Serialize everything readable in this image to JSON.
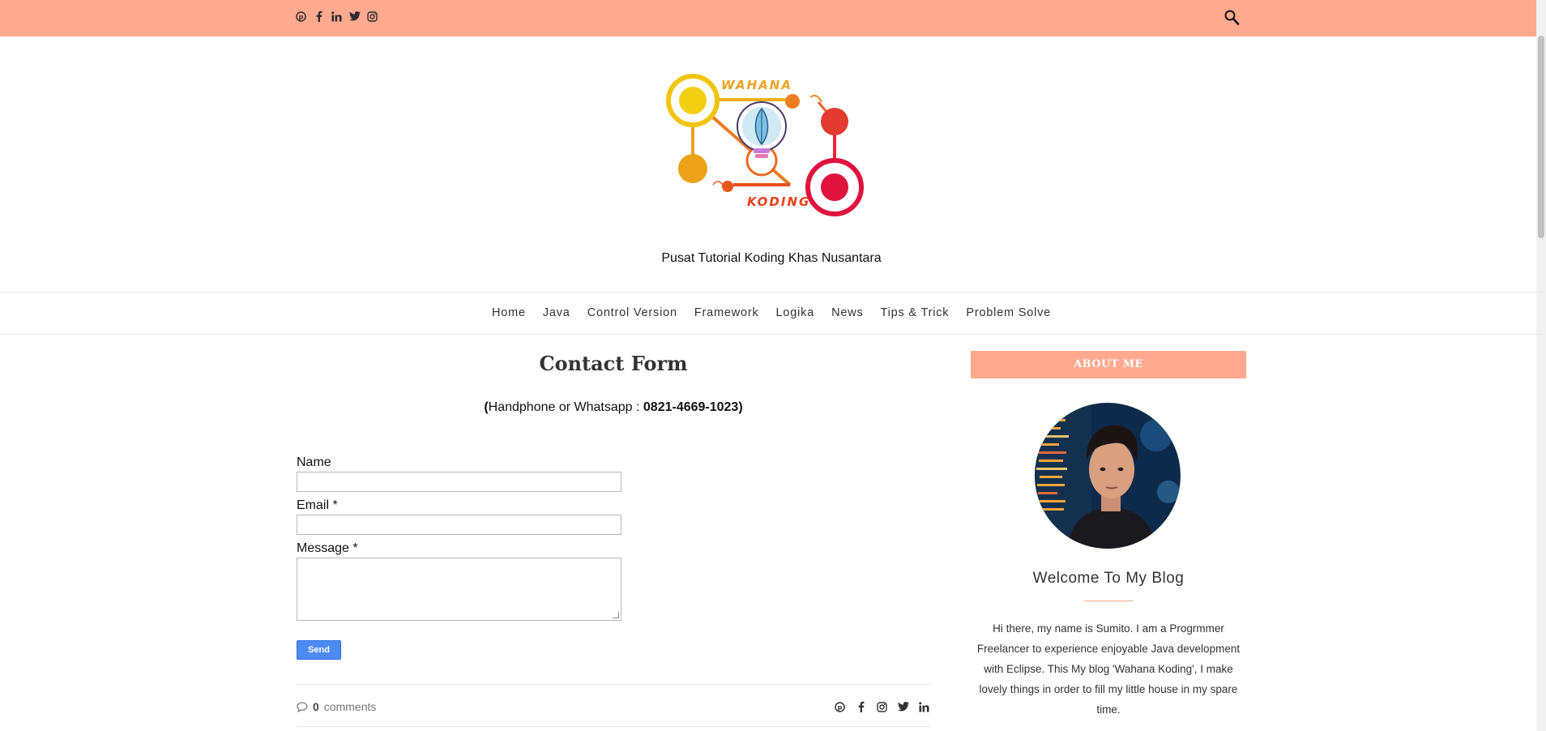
{
  "social_top": [
    {
      "name": "pinterest-icon",
      "glyph": "℗"
    },
    {
      "name": "facebook-icon",
      "glyph": "f"
    },
    {
      "name": "linkedin-icon",
      "glyph": "in"
    },
    {
      "name": "twitter-icon",
      "glyph": "t"
    },
    {
      "name": "instagram-icon",
      "glyph": "◎"
    }
  ],
  "logo": {
    "top_text": "WAHANA",
    "bottom_text": "KODING"
  },
  "site": {
    "tagline": "Pusat Tutorial Koding Khas Nusantara"
  },
  "nav": {
    "items": [
      "Home",
      "Java",
      "Control Version",
      "Framework",
      "Logika",
      "News",
      "Tips & Trick",
      "Problem Solve"
    ]
  },
  "page": {
    "title": "Contact Form",
    "contact_prefix": "(",
    "contact_label": "Handphone or Whatsapp : ",
    "contact_number": "0821-4669-1023)"
  },
  "form": {
    "name_label": "Name",
    "email_label": "Email *",
    "message_label": "Message *",
    "send_label": "Send"
  },
  "post_footer": {
    "comment_count": "0",
    "comment_label": "comments"
  },
  "sidebar": {
    "widget_title": "ABOUT ME",
    "welcome": "Welcome To My Blog",
    "about_text": "Hi there, my name is Sumito. I am a Progrmmer Freelancer to experience enjoyable Java development with Eclipse. This My blog 'Wahana Koding', I make lovely things in order to fill my little house in my spare time."
  },
  "colors": {
    "accent": "#ffa98f",
    "button": "#4c8bf5"
  }
}
